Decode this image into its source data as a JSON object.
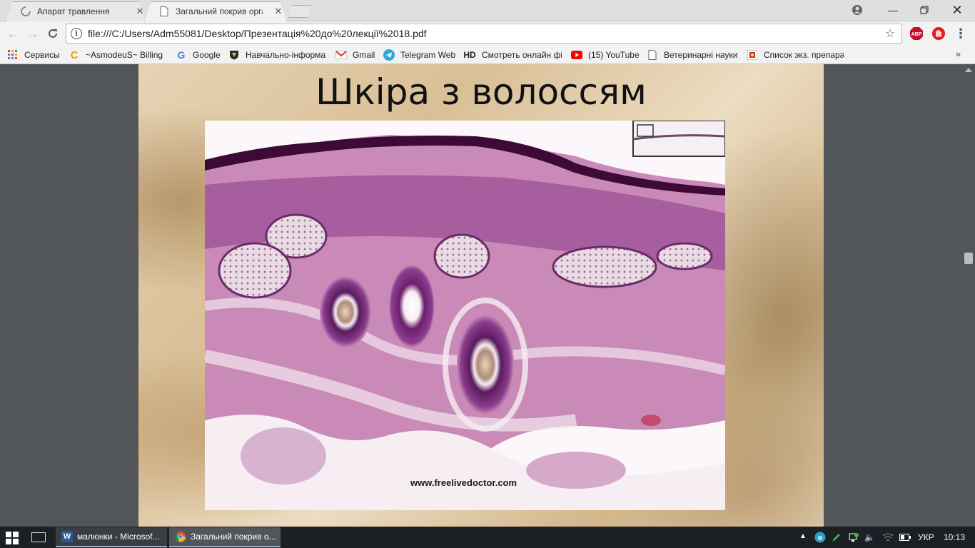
{
  "browser": {
    "tabs": [
      {
        "title": "Апарат травлення",
        "active": false,
        "loading": true
      },
      {
        "title": "Загальний покрив орган",
        "active": true
      }
    ],
    "url": "file:///C:/Users/Adm55081/Desktop/Презентація%20до%20лекції%2018.pdf",
    "extensions": [
      {
        "name": "adblock-plus-icon",
        "label": "ABP",
        "color": "#c70d2c"
      },
      {
        "name": "adblock-hand-icon",
        "color": "#e51b1b"
      }
    ]
  },
  "bookmarks": [
    {
      "label": "Сервисы",
      "icon": "apps-grid-icon"
    },
    {
      "label": "~AsmodeuS~ Billing",
      "icon": "c-logo-icon"
    },
    {
      "label": "Google",
      "icon": "google-icon"
    },
    {
      "label": "Навчально-інформа",
      "icon": "shield-logo-icon"
    },
    {
      "label": "Gmail",
      "icon": "gmail-icon"
    },
    {
      "label": "Telegram Web",
      "icon": "telegram-icon"
    },
    {
      "label": "Смотреть онлайн фі",
      "icon": "hd-icon",
      "badge": "HD"
    },
    {
      "label": "(15) YouTube",
      "icon": "youtube-icon"
    },
    {
      "label": "Ветеринарні науки",
      "icon": "page-icon"
    },
    {
      "label": "Список экз. препара",
      "icon": "site-logo-icon"
    }
  ],
  "slide": {
    "title": "Шкіра з волоссям",
    "image_watermark": "www.freelivedoctor.com"
  },
  "taskbar": {
    "apps": [
      {
        "label": "малюнки - Microsof...",
        "icon": "word-icon",
        "active": false
      },
      {
        "label": "Загальний покрив о...",
        "icon": "chrome-icon",
        "active": true
      }
    ],
    "language": "УКР",
    "time": "10:13"
  },
  "colors": {
    "tissue_pink": "#c98ab8",
    "tissue_purple": "#7a2b78",
    "epidermis": "#3d0a35",
    "slide_bg": "#ddc6a0"
  }
}
